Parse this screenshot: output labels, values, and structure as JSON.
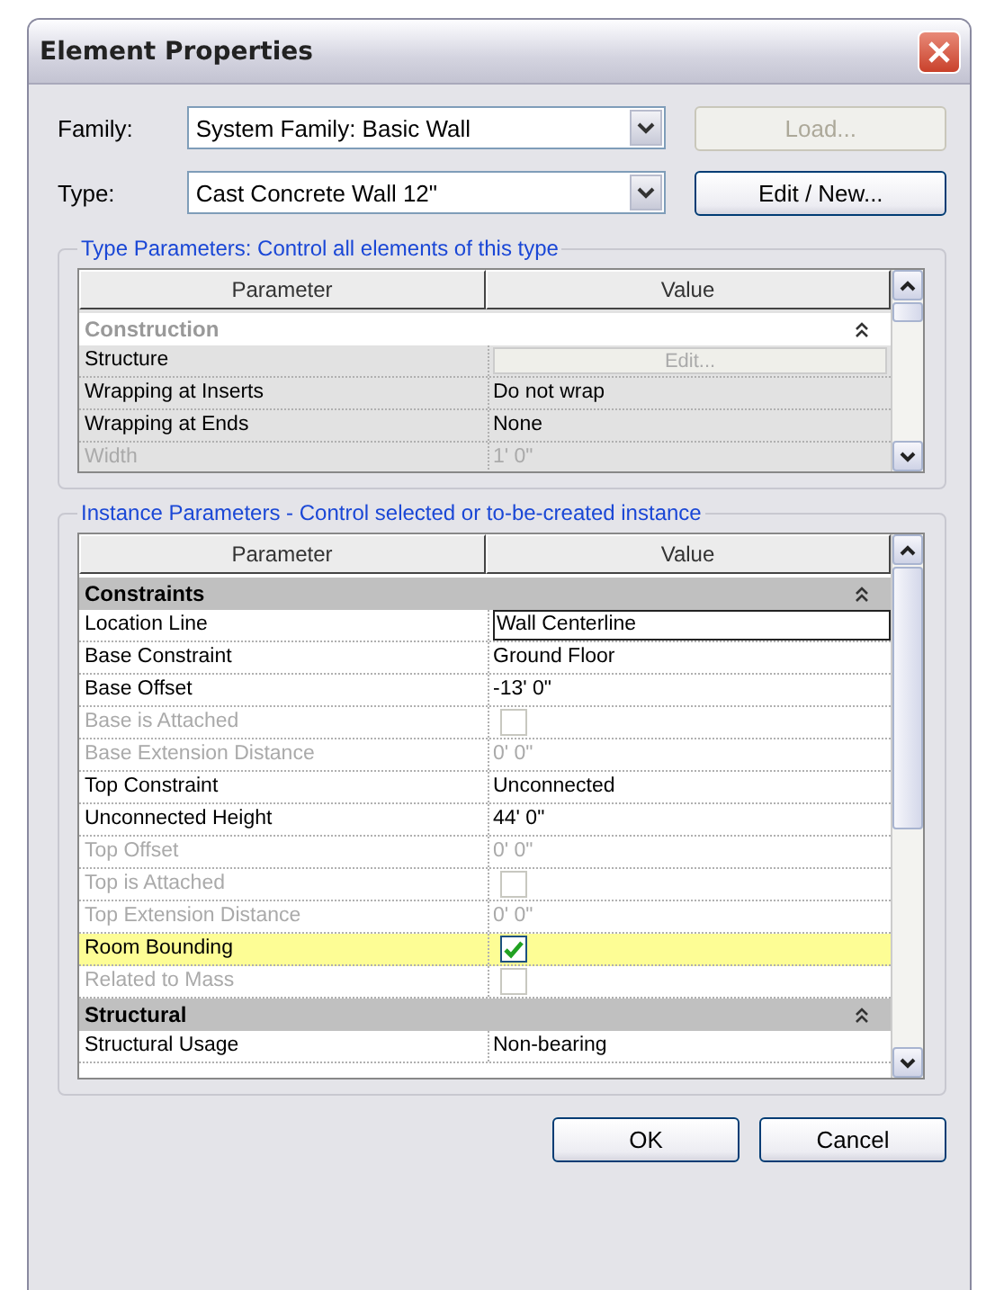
{
  "window": {
    "title": "Element Properties"
  },
  "family": {
    "label": "Family:",
    "value": "System Family: Basic Wall"
  },
  "type": {
    "label": "Type:",
    "value": "Cast Concrete Wall 12\""
  },
  "load_button": {
    "label": "Load...",
    "disabled": true
  },
  "edit_button": {
    "label": "Edit / New...",
    "disabled": false
  },
  "type_parameters": {
    "title": "Type Parameters: Control all elements of this type",
    "read_only": true,
    "columns": [
      "Parameter",
      "Value"
    ],
    "rows": [
      {
        "kind": "group",
        "name": "Construction",
        "disabled": true,
        "expanded": true
      },
      {
        "kind": "button",
        "name": "Structure",
        "value": "Edit...",
        "disabled": false
      },
      {
        "kind": "text",
        "name": "Wrapping at Inserts",
        "value": "Do not wrap",
        "disabled": false
      },
      {
        "kind": "text",
        "name": "Wrapping at Ends",
        "value": "None",
        "disabled": false
      },
      {
        "kind": "text",
        "name": "Width",
        "value": "1'  0\"",
        "disabled": true
      }
    ]
  },
  "instance_parameters": {
    "title": "Instance Parameters - Control selected or to-be-created instance",
    "read_only": false,
    "columns": [
      "Parameter",
      "Value"
    ],
    "rows": [
      {
        "kind": "group",
        "name": "Constraints",
        "disabled": false,
        "expanded": true
      },
      {
        "kind": "field",
        "name": "Location Line",
        "value": "Wall Centerline",
        "disabled": false,
        "selected": false
      },
      {
        "kind": "text",
        "name": "Base Constraint",
        "value": "Ground Floor",
        "disabled": false,
        "selected": false
      },
      {
        "kind": "text",
        "name": "Base Offset",
        "value": "-13'  0\"",
        "disabled": false,
        "selected": false
      },
      {
        "kind": "checkbox",
        "name": "Base is Attached",
        "checked": false,
        "disabled": true,
        "selected": false
      },
      {
        "kind": "text",
        "name": "Base Extension Distance",
        "value": "0'  0\"",
        "disabled": true,
        "selected": false
      },
      {
        "kind": "text",
        "name": "Top Constraint",
        "value": "Unconnected",
        "disabled": false,
        "selected": false
      },
      {
        "kind": "text",
        "name": "Unconnected Height",
        "value": "44'  0\"",
        "disabled": false,
        "selected": false
      },
      {
        "kind": "text",
        "name": "Top Offset",
        "value": "0'  0\"",
        "disabled": true,
        "selected": false
      },
      {
        "kind": "checkbox",
        "name": "Top is Attached",
        "checked": false,
        "disabled": true,
        "selected": false
      },
      {
        "kind": "text",
        "name": "Top Extension Distance",
        "value": "0'  0\"",
        "disabled": true,
        "selected": false
      },
      {
        "kind": "checkbox",
        "name": "Room Bounding",
        "checked": true,
        "disabled": false,
        "selected": true
      },
      {
        "kind": "checkbox",
        "name": "Related to Mass",
        "checked": false,
        "disabled": true,
        "selected": false
      },
      {
        "kind": "group",
        "name": "Structural",
        "disabled": false,
        "expanded": true
      },
      {
        "kind": "text",
        "name": "Structural Usage",
        "value": "Non-bearing",
        "disabled": false,
        "selected": false
      }
    ]
  },
  "buttons": [
    {
      "label": "OK"
    },
    {
      "label": "Cancel"
    }
  ]
}
